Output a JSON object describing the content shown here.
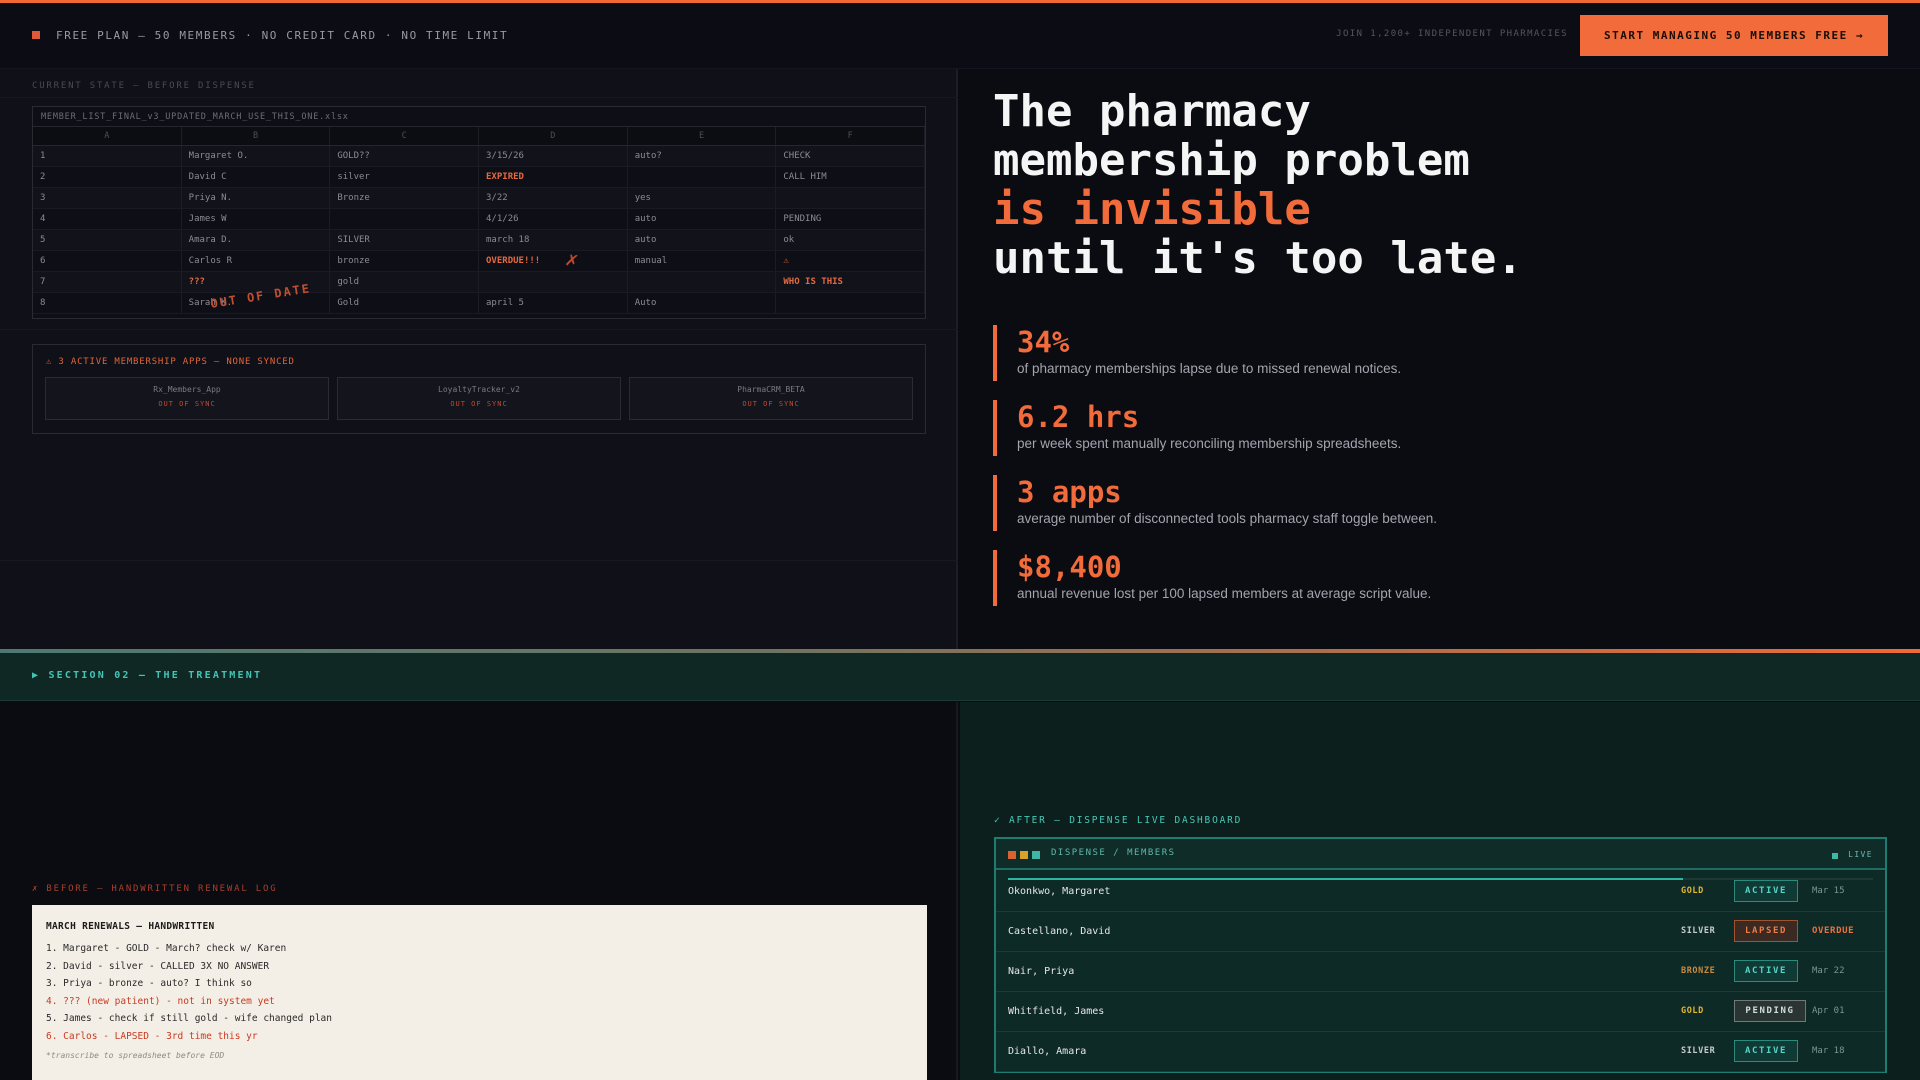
{
  "header": {
    "plan_text": "FREE PLAN — 50 MEMBERS · NO CREDIT CARD · NO TIME LIMIT",
    "join_text": "JOIN 1,200+ INDEPENDENT PHARMACIES",
    "cta_label": "START MANAGING 50 MEMBERS FREE →"
  },
  "before_panel": {
    "state_label": "CURRENT STATE — BEFORE DISPENSE",
    "sheet_title": "MEMBER_LIST_FINAL_v3_UPDATED_MARCH_USE_THIS_ONE.xlsx",
    "columns": [
      "A",
      "B",
      "C",
      "D",
      "E",
      "F"
    ],
    "rows": [
      [
        "1",
        "Margaret O.",
        "GOLD??",
        "3/15/26",
        "auto?",
        "CHECK"
      ],
      [
        "2",
        "David C",
        "silver",
        "EXPIRED",
        "",
        "CALL HIM"
      ],
      [
        "3",
        "Priya N.",
        "Bronze",
        "3/22",
        "yes",
        ""
      ],
      [
        "4",
        "James W",
        "",
        "4/1/26",
        "auto",
        "PENDING"
      ],
      [
        "5",
        "Amara D.",
        "SILVER",
        "march 18",
        "auto",
        "ok"
      ],
      [
        "6",
        "Carlos R",
        "bronze",
        "OVERDUE!!!",
        "manual",
        "⚠"
      ],
      [
        "7",
        "???",
        "gold",
        "",
        "",
        "WHO IS THIS"
      ],
      [
        "8",
        "Sarah K.",
        "Gold",
        "april 5",
        "Auto",
        ""
      ]
    ],
    "stamp": "OUT OF DATE",
    "xmark": "✗",
    "apps_title": "⚠ 3 ACTIVE MEMBERSHIP APPS — NONE SYNCED",
    "apps": [
      {
        "name": "Rx_Members_App",
        "status": "OUT OF SYNC"
      },
      {
        "name": "LoyaltyTracker_v2",
        "status": "OUT OF SYNC"
      },
      {
        "name": "PharmaCRM_BETA",
        "status": "OUT OF SYNC"
      }
    ]
  },
  "hero": {
    "line1": "The pharmacy",
    "line2": "membership problem",
    "accent": "is invisible",
    "line4": "until it's too late."
  },
  "stats": [
    {
      "value": "34%",
      "desc": "of pharmacy memberships lapse due to missed renewal notices."
    },
    {
      "value": "6.2 hrs",
      "desc": "per week spent manually reconciling membership spreadsheets."
    },
    {
      "value": "3 apps",
      "desc": "average number of disconnected tools pharmacy staff toggle between."
    },
    {
      "value": "$8,400",
      "desc": "annual revenue lost per 100 lapsed members at average script value."
    }
  ],
  "section2": {
    "label": "▶ SECTION 02 — THE TREATMENT"
  },
  "handwritten": {
    "label": "✗ BEFORE — HANDWRITTEN RENEWAL LOG",
    "title": "MARCH RENEWALS — HANDWRITTEN",
    "lines": [
      "1. Margaret - GOLD - March? check w/ Karen",
      "2. David - silver - CALLED 3X NO ANSWER",
      "3. Priya - bronze - auto? I think so",
      "4. ??? (new patient) - not in system yet",
      "5. James - check if still gold - wife changed plan",
      "6. Carlos - LAPSED - 3rd time this yr"
    ],
    "red_lines": [
      3,
      5
    ],
    "note": "*transcribe to spreadsheet before EOD"
  },
  "dashboard": {
    "label": "✓ AFTER — DISPENSE LIVE DASHBOARD",
    "title": "DISPENSE / MEMBERS",
    "live": "LIVE",
    "progress": 0.78,
    "window_dots": [
      "#d9632f",
      "#d8a127",
      "#3fb7a7"
    ],
    "members": [
      {
        "name": "Okonkwo, Margaret",
        "tier": "GOLD",
        "status": "ACTIVE",
        "date": "Mar 15"
      },
      {
        "name": "Castellano, David",
        "tier": "SILVER",
        "status": "LAPSED",
        "date": "OVERDUE"
      },
      {
        "name": "Nair, Priya",
        "tier": "BRONZE",
        "status": "ACTIVE",
        "date": "Mar 22"
      },
      {
        "name": "Whitfield, James",
        "tier": "GOLD",
        "status": "PENDING",
        "date": "Apr 01"
      },
      {
        "name": "Diallo, Amara",
        "tier": "SILVER",
        "status": "ACTIVE",
        "date": "Mar 18"
      }
    ],
    "tier_colors": {
      "GOLD": "#e3b82c",
      "SILVER": "#c8ccd0",
      "BRONZE": "#c98a3e"
    },
    "status_colors": {
      "ACTIVE": {
        "bg": "#0f3a36",
        "border": "#2a8a7e",
        "fg": "#55d6c6"
      },
      "LAPSED": {
        "bg": "#3a2a22",
        "border": "#a2522f",
        "fg": "#ef7a44"
      },
      "PENDING": {
        "bg": "#2a3533",
        "border": "#6e7a78",
        "fg": "#d4dcdb"
      }
    }
  },
  "colors": {
    "accent": "#f26b3a",
    "teal": "#43c4b5",
    "bg": "#0b0b12"
  }
}
